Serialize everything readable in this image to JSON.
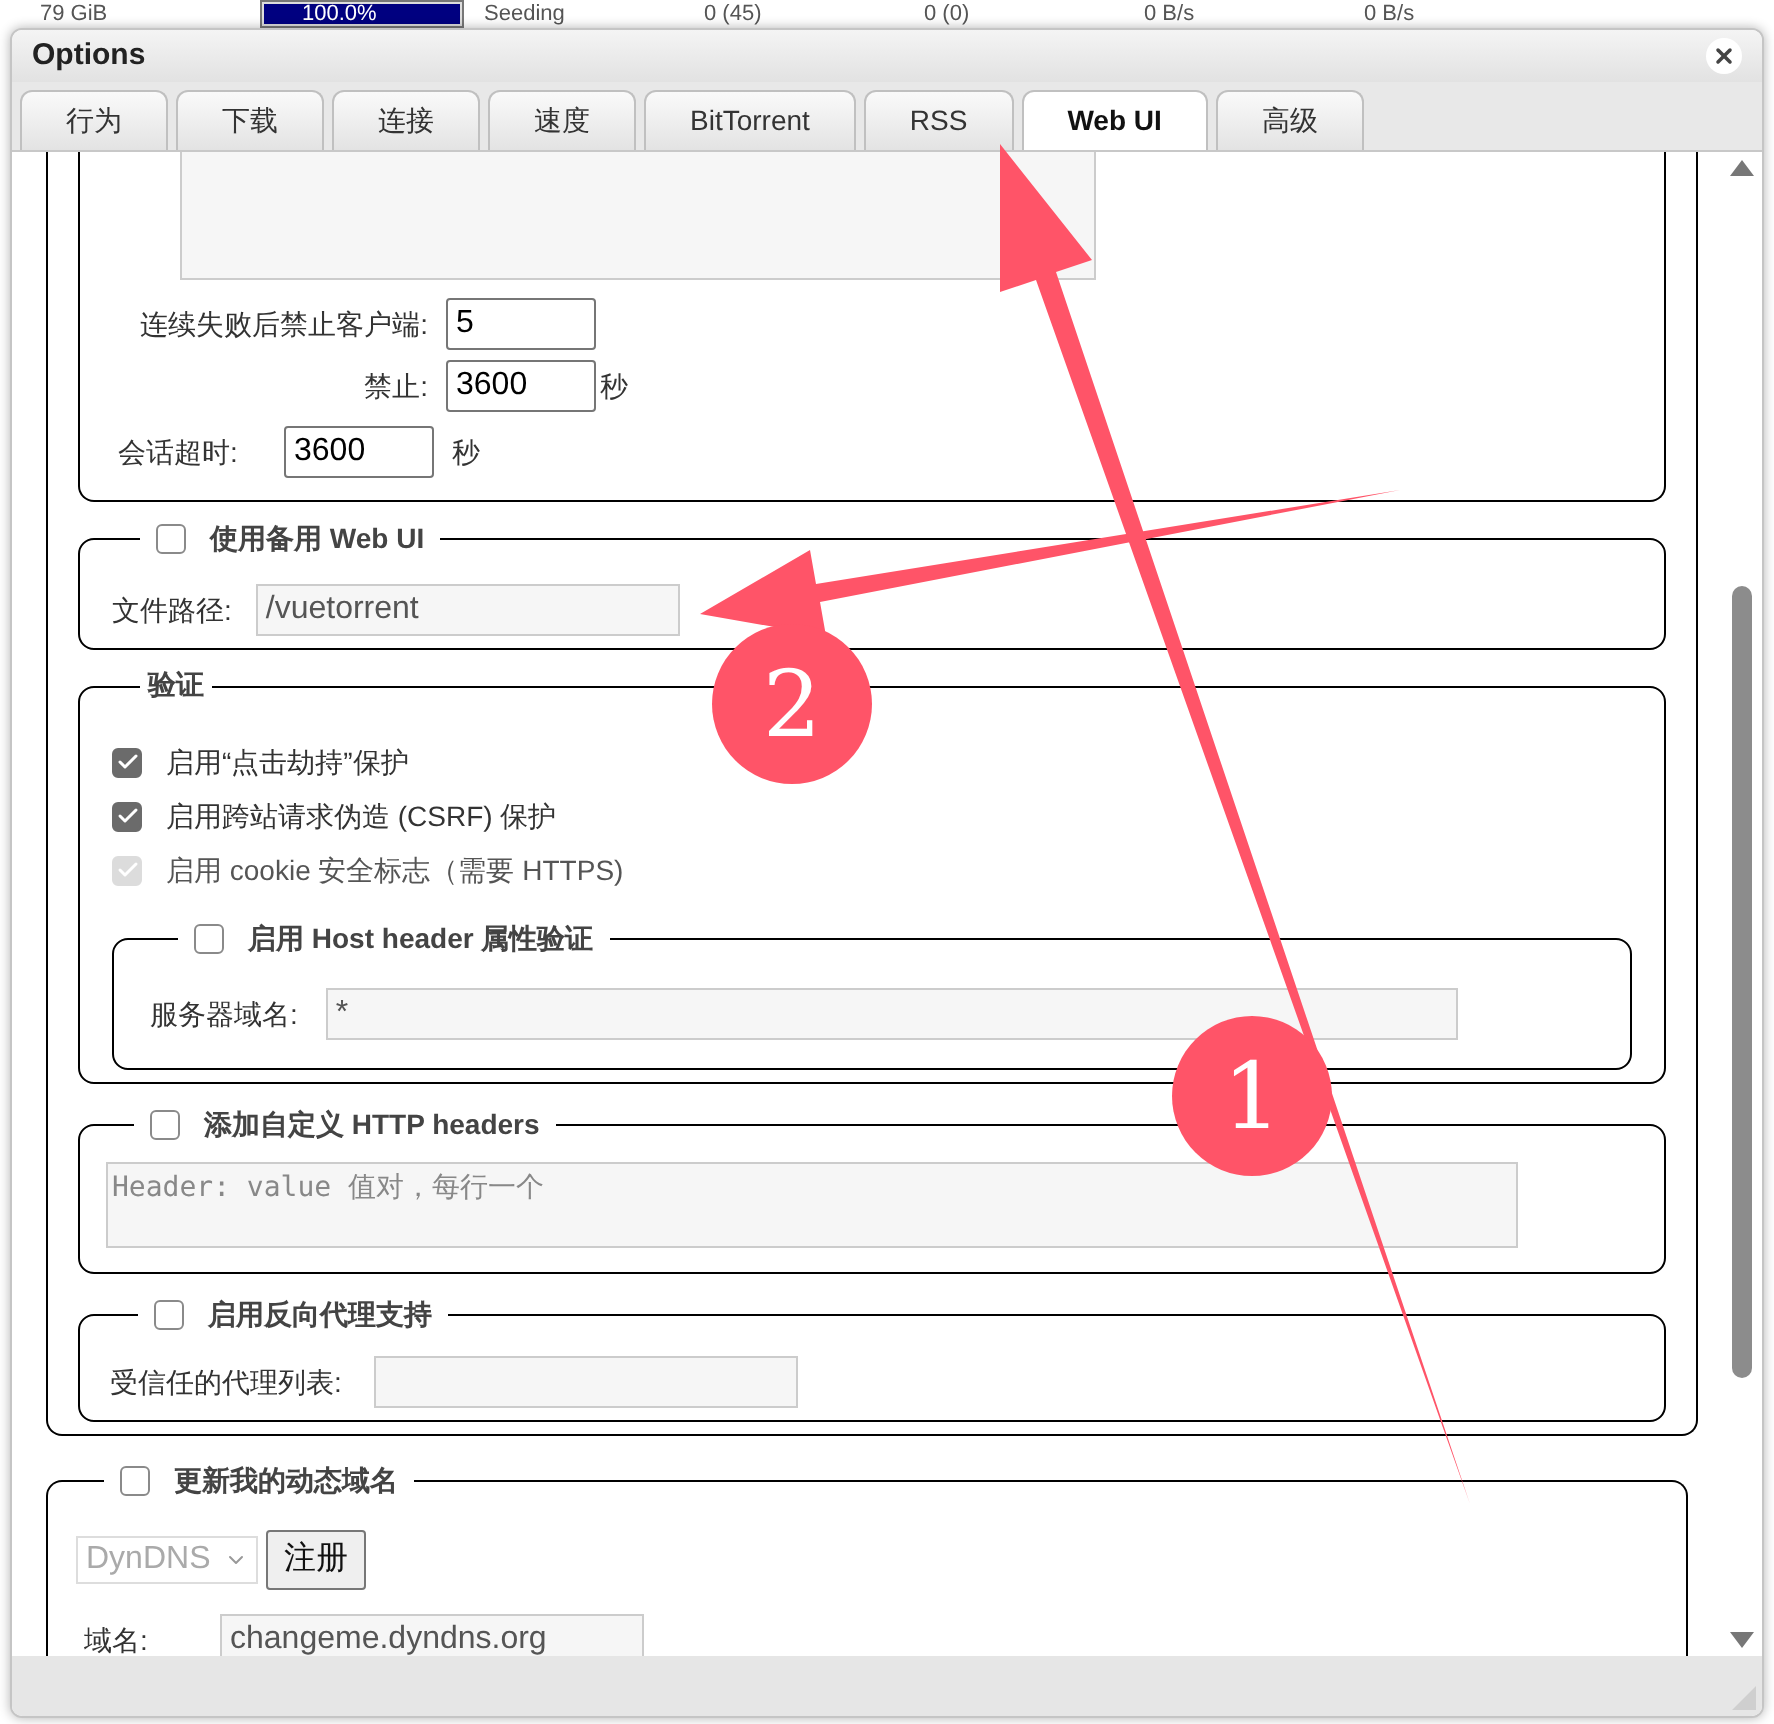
{
  "background_row": [
    "79 GiB",
    "100.0%",
    "Seeding",
    "0 (45)",
    "0 (0)",
    "0 B/s",
    "0 B/s"
  ],
  "background_progress": {
    "level": 1
  },
  "window": {
    "title": "Options"
  },
  "tabs": [
    {
      "label": "行为",
      "selected": false
    },
    {
      "label": "下载",
      "selected": false
    },
    {
      "label": "连接",
      "selected": false
    },
    {
      "label": "速度",
      "selected": false
    },
    {
      "label": "BitTorrent",
      "selected": false
    },
    {
      "label": "RSS",
      "selected": false
    },
    {
      "label": "Web UI",
      "selected": true
    },
    {
      "label": "高级",
      "selected": false
    }
  ],
  "security": {
    "ban_after": {
      "label": "连续失败后禁止客户端:",
      "value": "5"
    },
    "ban_duration": {
      "label": "禁止:",
      "value": "3600",
      "unit": "秒"
    },
    "session_timeout": {
      "label": "会话超时:",
      "value": "3600",
      "unit": "秒"
    }
  },
  "alt_webui": {
    "label": "使用备用 Web UI",
    "checked": false,
    "path_label": "文件路径:",
    "path_value": "/vuetorrent"
  },
  "auth": {
    "legend": "验证",
    "options": [
      {
        "label": "启用“点击劫持”保护",
        "checked": true,
        "disabled": false
      },
      {
        "label": "启用跨站请求伪造 (CSRF) 保护",
        "checked": true,
        "disabled": false
      },
      {
        "label": "启用 cookie 安全标志（需要 HTTPS)",
        "checked": true,
        "disabled": true
      }
    ],
    "host_header": {
      "label": "启用 Host header 属性验证",
      "checked": false,
      "field_label": "服务器域名:",
      "value": "*"
    }
  },
  "custom_headers": {
    "label": "添加自定义 HTTP headers",
    "checked": false,
    "placeholder": "Header: value 值对，每行一个"
  },
  "reverse_proxy": {
    "label": "启用反向代理支持",
    "checked": false,
    "field_label": "受信任的代理列表:"
  },
  "ddns": {
    "label": "更新我的动态域名",
    "checked": false,
    "service": "DynDNS",
    "register_button": "注册",
    "domain_label": "域名:",
    "domain_value": "changeme.dyndns.org"
  },
  "annotations": [
    {
      "number": "2"
    },
    {
      "number": "1"
    }
  ]
}
